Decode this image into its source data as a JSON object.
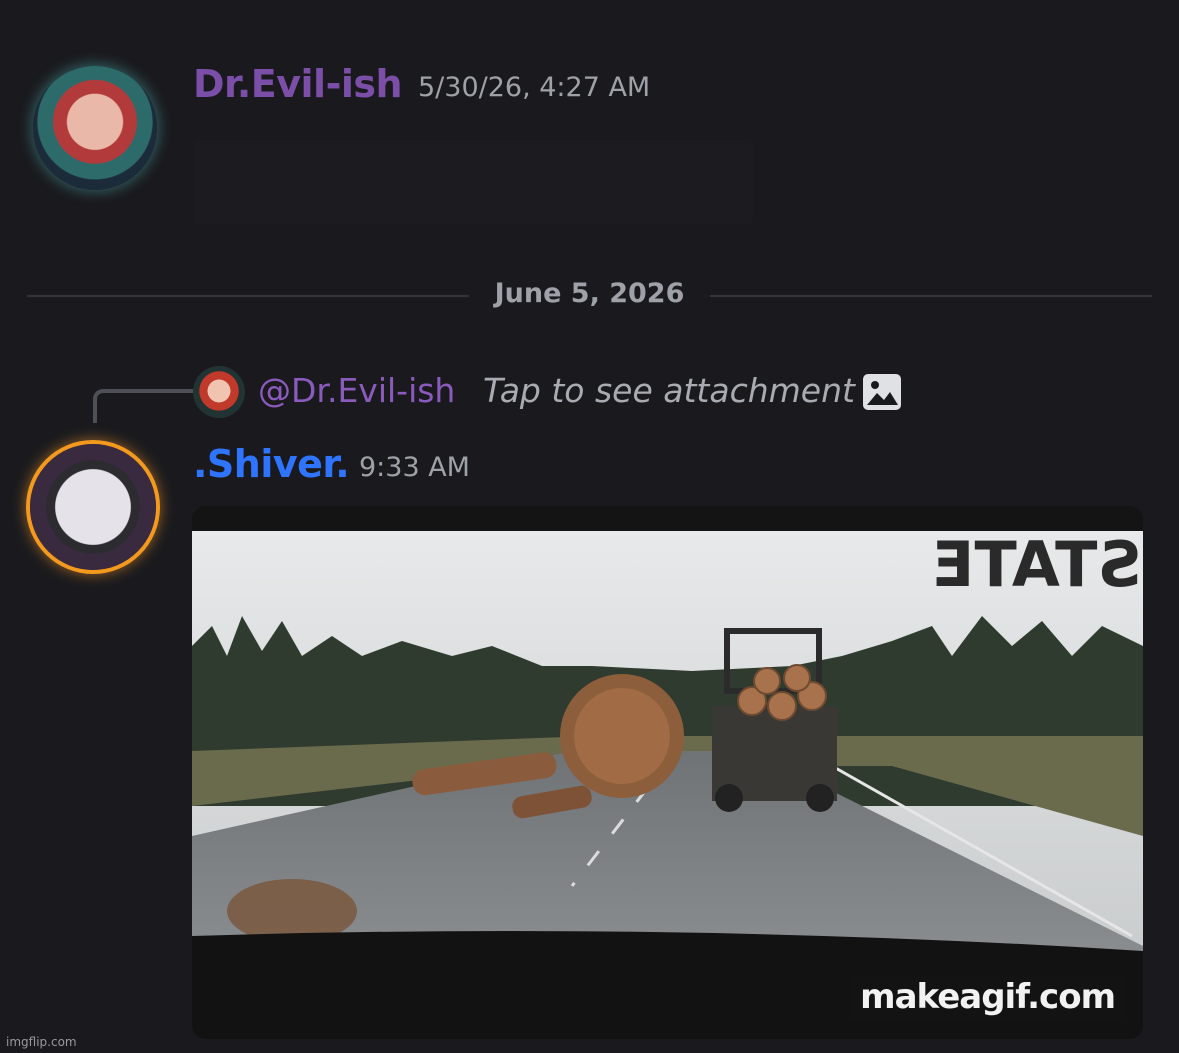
{
  "messages": [
    {
      "author": "Dr.Evil-ish",
      "timestamp": "5/30/26, 4:27 AM",
      "author_color": "#7b4fa8"
    },
    {
      "author": ".Shiver.",
      "timestamp": "9:33 AM",
      "author_color": "#2f74ff",
      "reply": {
        "mention": "@Dr.Evil-ish",
        "text": "Tap to see attachment",
        "icon": "image-icon"
      },
      "attachment": {
        "type": "gif",
        "watermark": "makeagif.com",
        "sign_text": "STATE"
      }
    }
  ],
  "divider": {
    "date": "June 5, 2026"
  },
  "footer": {
    "credit": "imgflip.com"
  }
}
